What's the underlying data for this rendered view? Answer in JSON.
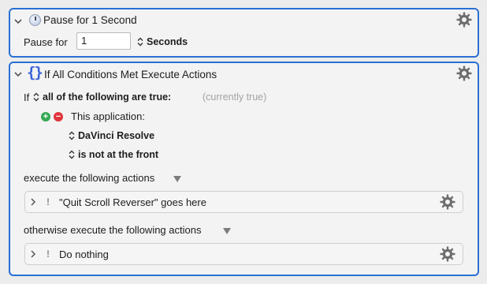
{
  "action1": {
    "title": "Pause for 1 Second",
    "pause_label": "Pause for",
    "pause_value": "1",
    "unit": "Seconds",
    "icon": "clock-icon"
  },
  "action2": {
    "title": "If All Conditions Met Execute Actions",
    "icon": "braces-icon",
    "if_label": "If",
    "condition_mode": "all of the following are true:",
    "status": "(currently true)",
    "condition": {
      "label": "This application:",
      "app": "DaVinci Resolve",
      "state": "is not at the front"
    },
    "execute_label": "execute the following actions",
    "execute_action": "\"Quit Scroll Reverser\" goes here",
    "otherwise_label": "otherwise execute the following actions",
    "otherwise_action": "Do nothing",
    "bang": "!"
  },
  "colors": {
    "accent_border": "#2a6fd4",
    "add": "#33a852",
    "remove": "#e0343c"
  }
}
